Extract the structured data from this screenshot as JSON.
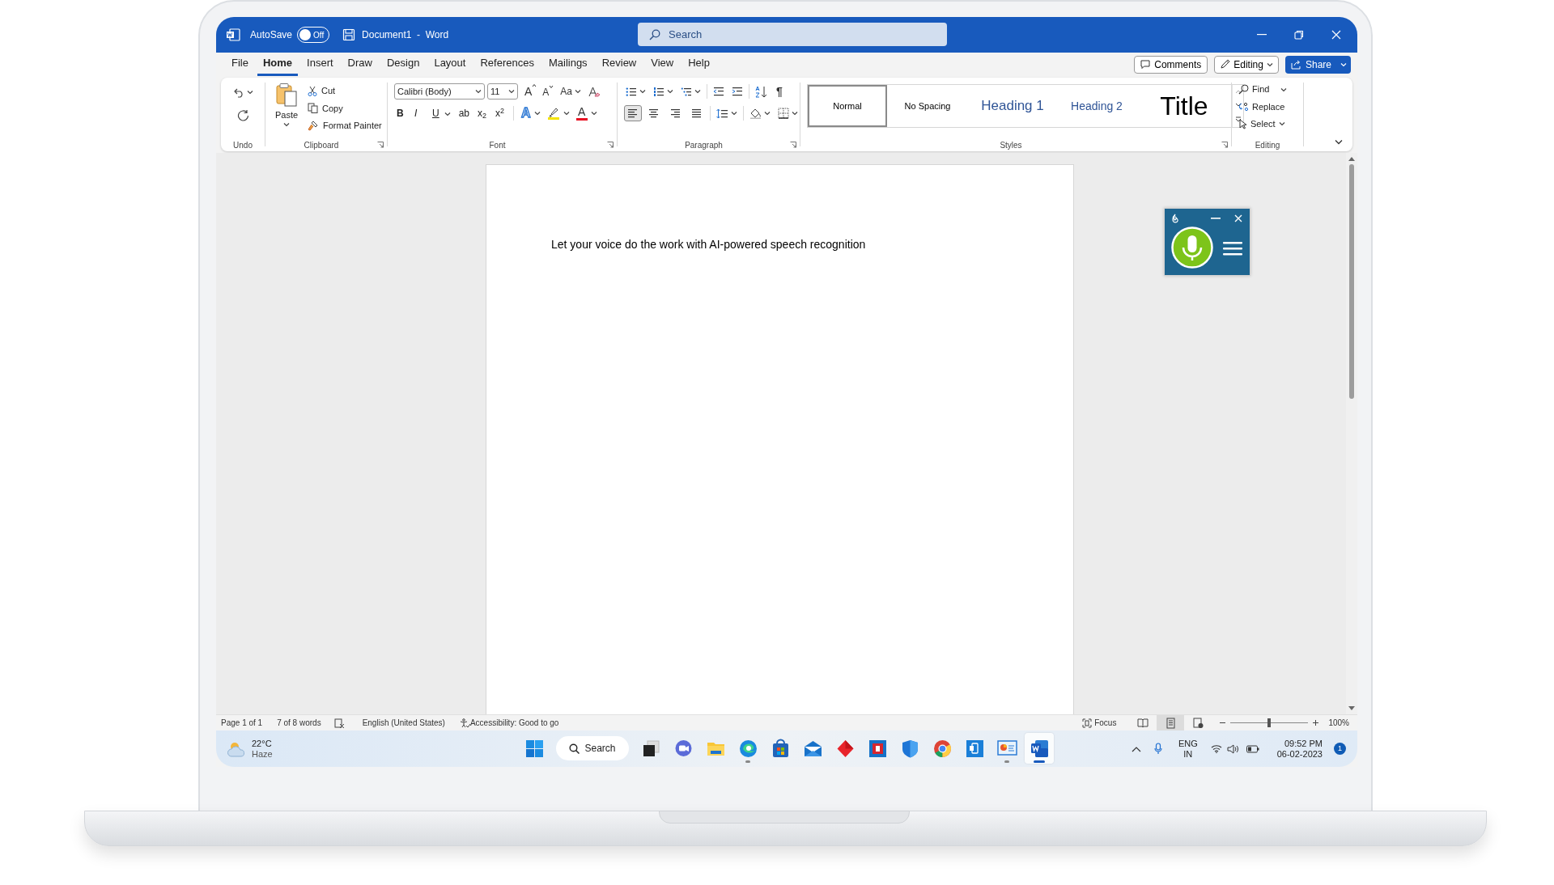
{
  "title_bar": {
    "autosave_label": "AutoSave",
    "autosave_toggle": {
      "on": false,
      "label": "Off"
    },
    "document_title": "Document1  -  Word",
    "search": {
      "placeholder": "Search"
    }
  },
  "menu_tabs": [
    {
      "label": "File",
      "selected": false
    },
    {
      "label": "Home",
      "selected": true
    },
    {
      "label": "Insert",
      "selected": false
    },
    {
      "label": "Draw",
      "selected": false
    },
    {
      "label": "Design",
      "selected": false
    },
    {
      "label": "Layout",
      "selected": false
    },
    {
      "label": "References",
      "selected": false
    },
    {
      "label": "Mailings",
      "selected": false
    },
    {
      "label": "Review",
      "selected": false
    },
    {
      "label": "View",
      "selected": false
    },
    {
      "label": "Help",
      "selected": false
    }
  ],
  "header_buttons": {
    "comments": "Comments",
    "editing": "Editing",
    "share": "Share"
  },
  "ribbon": {
    "undo": {
      "label": "Undo"
    },
    "clipboard": {
      "label": "Clipboard",
      "paste": "Paste",
      "cut": "Cut",
      "copy": "Copy",
      "format_painter": "Format Painter"
    },
    "font": {
      "label": "Font",
      "font_name": "Calibri (Body)",
      "font_size": "11",
      "grow": "A",
      "shrink": "A",
      "change_case": "Aa",
      "format_buttons": [
        {
          "kind": "bold",
          "glyph": "B"
        },
        {
          "kind": "italic",
          "glyph": "I"
        },
        {
          "kind": "underline",
          "glyph": "U"
        },
        {
          "kind": "strike",
          "glyph": "ab"
        },
        {
          "kind": "sub",
          "glyph": "x$_{2}$"
        },
        {
          "kind": "sup",
          "glyph": "x$^{2}$"
        }
      ],
      "color_buttons": [
        {
          "kind": "effects",
          "glyph": "A"
        },
        {
          "kind": "highlight"
        },
        {
          "kind": "color",
          "glyph": "A"
        }
      ]
    },
    "paragraph": {
      "label": "Paragraph",
      "pilcrow": "¶",
      "alignments": [
        {
          "kind": "left",
          "selected": true
        },
        {
          "kind": "center",
          "selected": false
        },
        {
          "kind": "right",
          "selected": false
        },
        {
          "kind": "justify",
          "selected": false
        }
      ]
    },
    "styles": {
      "label": "Styles",
      "items": [
        {
          "kind": "normal",
          "label": "Normal",
          "selected": true
        },
        {
          "kind": "no-spacing",
          "label": "No Spacing",
          "selected": false
        },
        {
          "kind": "heading1",
          "label": "Heading 1",
          "selected": false
        },
        {
          "kind": "heading2",
          "label": "Heading 2",
          "selected": false
        },
        {
          "kind": "title",
          "label": "Title",
          "selected": false
        }
      ]
    },
    "editing": {
      "label": "Editing",
      "find": "Find",
      "replace": "Replace",
      "select": "Select"
    }
  },
  "document": {
    "text": "Let your voice do the work with AI-powered speech recognition"
  },
  "status_bar": {
    "page": "Page 1 of 1",
    "words": "7 of 8 words",
    "language": "English (United States)",
    "accessibility": "Accessibility: Good to go",
    "focus": "Focus",
    "views": [
      {
        "kind": "read",
        "selected": false
      },
      {
        "kind": "print",
        "selected": true
      },
      {
        "kind": "web",
        "selected": false
      }
    ],
    "zoom": {
      "level": 0.5,
      "reading": "100%"
    }
  },
  "taskbar": {
    "weather": {
      "temperature": "22°C",
      "condition": "Haze"
    },
    "search": "Search",
    "apps": [
      {
        "kind": "start",
        "running": false,
        "active": false
      },
      {
        "kind": "search"
      },
      {
        "kind": "task-view",
        "running": false,
        "active": false
      },
      {
        "kind": "chat",
        "running": false,
        "active": false
      },
      {
        "kind": "files",
        "running": false,
        "active": false
      },
      {
        "kind": "edge",
        "running": true,
        "active": false
      },
      {
        "kind": "store",
        "running": false,
        "active": false
      },
      {
        "kind": "mail",
        "running": false,
        "active": false
      },
      {
        "kind": "diamond",
        "running": false,
        "active": false
      },
      {
        "kind": "red-app",
        "running": false,
        "active": false
      },
      {
        "kind": "shield",
        "running": false,
        "active": false
      },
      {
        "kind": "chrome",
        "running": false,
        "active": false
      },
      {
        "kind": "phone",
        "running": false,
        "active": false
      },
      {
        "kind": "whiteboard",
        "running": true,
        "active": false
      },
      {
        "kind": "word",
        "running": true,
        "active": true
      }
    ],
    "language": {
      "line1": "ENG",
      "line2": "IN"
    },
    "time": "09:52 PM",
    "date": "06-02-2023",
    "notifications": "1"
  }
}
